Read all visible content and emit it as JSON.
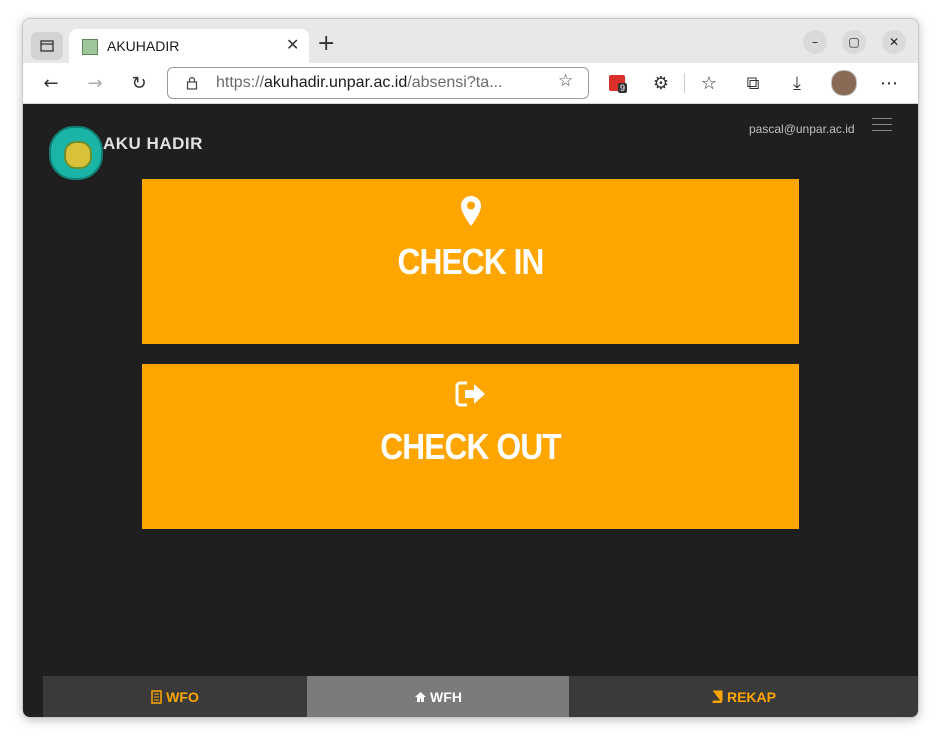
{
  "browser": {
    "tab_title": "AKUHADIR",
    "url_proto": "https://",
    "url_host": "akuhadir.unpar.ac.id",
    "url_path": "/absensi?ta...",
    "extension_badge": "9"
  },
  "app": {
    "brand": "AKU HADIR",
    "user_email": "pascal@unpar.ac.id"
  },
  "actions": {
    "check_in_label": "CHECK IN",
    "check_out_label": "CHECK OUT"
  },
  "bottom_nav": {
    "wfo_label": "WFO",
    "wfh_label": "WFH",
    "rekap_label": "REKAP",
    "active": "WFH"
  },
  "colors": {
    "accent": "#ffa500",
    "page_bg": "#1f1f1f",
    "nav_bg": "#3a3a3a",
    "nav_active_bg": "#7b7b7b"
  },
  "icons": {
    "check_in": "map-marker-icon",
    "check_out": "sign-out-icon",
    "wfo": "building-icon",
    "wfh": "home-icon",
    "rekap": "book-icon"
  }
}
